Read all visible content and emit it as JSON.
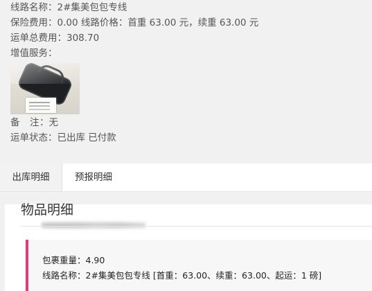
{
  "order": {
    "line_name": "线路名称：2#集美包包专线",
    "fees": "保险费用：0.00 线路价格：首重 63.00 元，续重 63.00 元",
    "total": "运单总费用：308.70",
    "value_added_label": "增值服务：",
    "remark_k1": "备",
    "remark_k2": "注",
    "remark_v": "：无",
    "status": "运单状态：已出库 已付款"
  },
  "tabs": [
    {
      "label": "出库明细",
      "active": true
    },
    {
      "label": "预报明细",
      "active": false
    }
  ],
  "detail": {
    "title": "物品明细",
    "weight": "包裹重量：4.90",
    "line": "线路名称：2#集美包包专线 [首重：63.00、续重：63.00、起运：1 磅]"
  },
  "colors": {
    "accent": "#e6397c",
    "background": "#f1f1f1",
    "text": "#555555"
  }
}
